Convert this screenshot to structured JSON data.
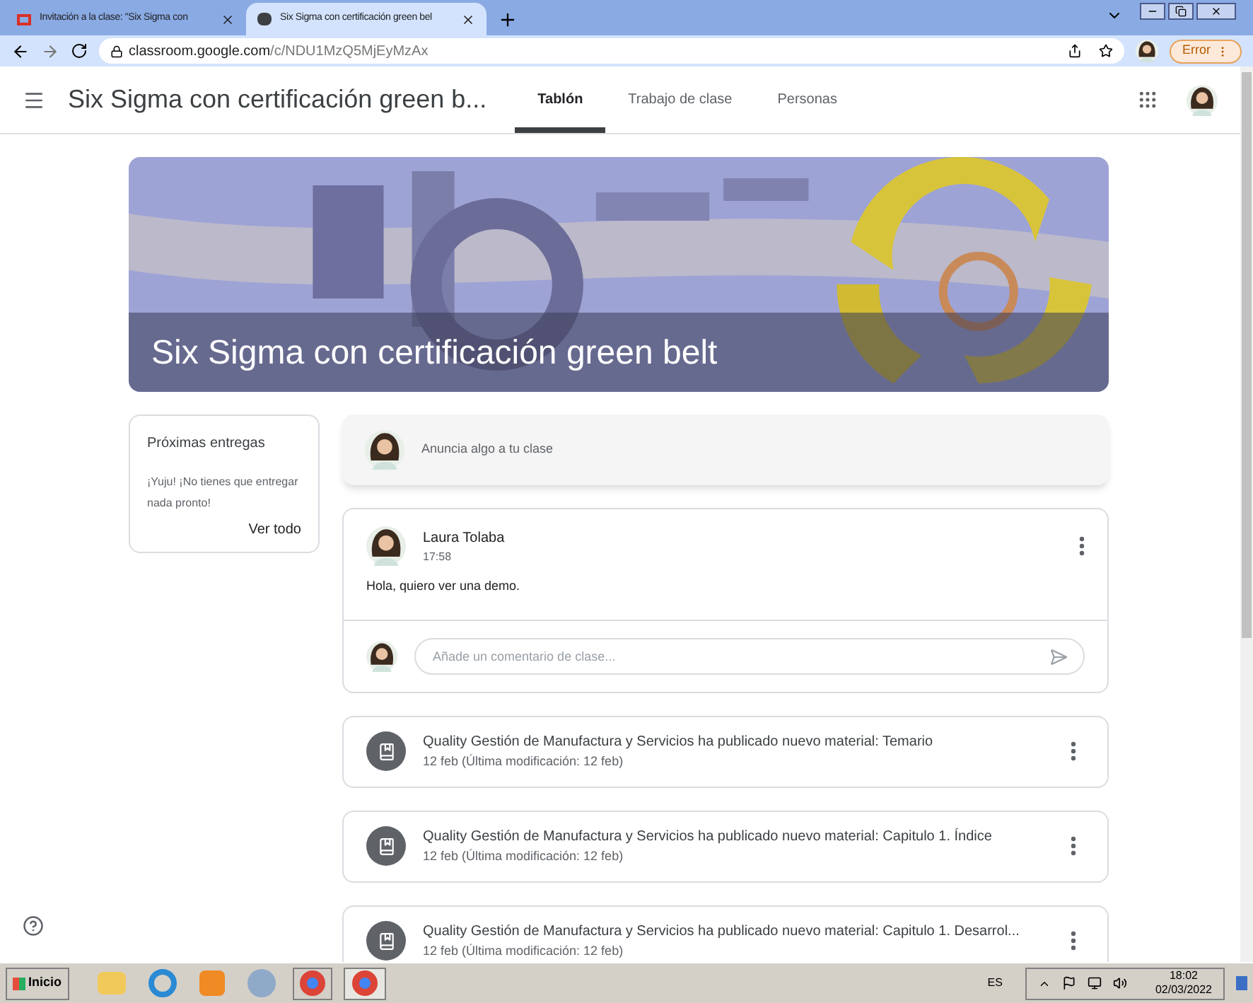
{
  "browser": {
    "tabs": [
      {
        "title": "Invitación a la clase: \"Six Sigma con",
        "selected": false
      },
      {
        "title": "Six Sigma con certificación green bel",
        "selected": true
      }
    ],
    "url_host": "classroom.google.com",
    "url_path": "/c/NDU1MzQ5MjEyMzAx",
    "profile_button": "Error"
  },
  "header": {
    "class_title": "Six Sigma con certificación green b...",
    "tabs": [
      {
        "label": "Tablón",
        "selected": true
      },
      {
        "label": "Trabajo de clase",
        "selected": false
      },
      {
        "label": "Personas",
        "selected": false
      }
    ]
  },
  "banner": {
    "title": "Six Sigma con certificación green belt"
  },
  "upcoming": {
    "title": "Próximas entregas",
    "message": "¡Yuju! ¡No tienes que entregar nada pronto!",
    "link": "Ver todo"
  },
  "announce": {
    "placeholder": "Anuncia algo a tu clase"
  },
  "post": {
    "author": "Laura Tolaba",
    "time": "17:58",
    "text": "Hola, quiero ver una demo.",
    "comment_placeholder": "Añade un comentario de clase..."
  },
  "materials": [
    {
      "title": "Quality Gestión de Manufactura y Servicios ha publicado nuevo material: Temario",
      "date": "12 feb (Última modificación: 12 feb)"
    },
    {
      "title": "Quality Gestión de Manufactura y Servicios ha publicado nuevo material: Capitulo 1. Índice",
      "date": "12 feb (Última modificación: 12 feb)"
    },
    {
      "title": "Quality Gestión de Manufactura y Servicios ha publicado nuevo material: Capitulo 1. Desarrol...",
      "date": "12 feb (Última modificación: 12 feb)"
    }
  ],
  "taskbar": {
    "start": "Inicio",
    "language": "ES",
    "time": "18:02",
    "date": "02/03/2022"
  }
}
